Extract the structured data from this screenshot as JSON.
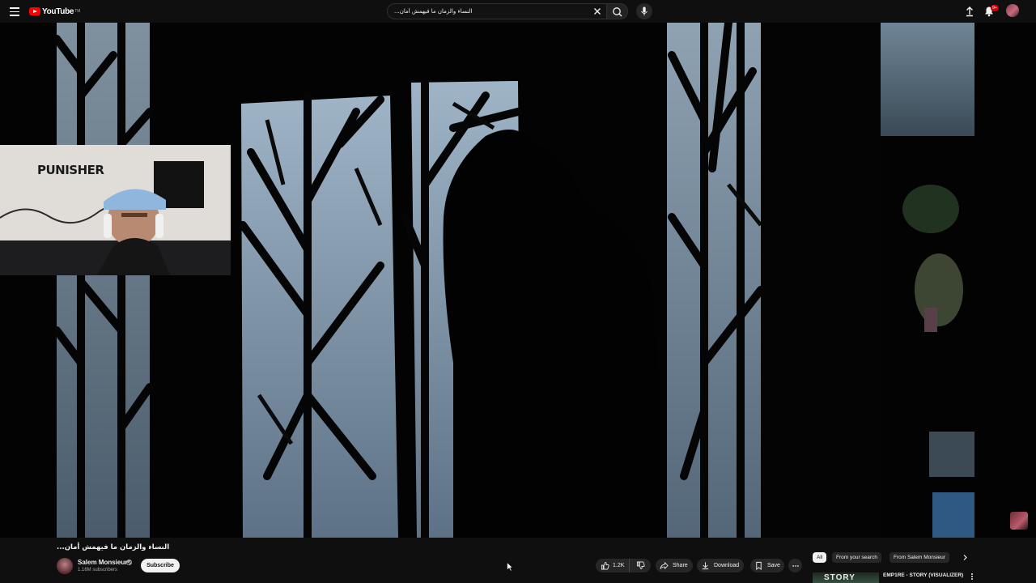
{
  "header": {
    "logo_text": "YouTube",
    "logo_tm": "TM",
    "search_value": "...النساء والزمان ما فيهمش أمان",
    "notification_count": "9+"
  },
  "video": {
    "title": "...النساء والزمان ما فيهمش أمان",
    "channel_name": "Salem Monsieur",
    "subscribers": "1.16M subscribers",
    "subscribe_label": "Subscribe",
    "webcam_poster_text": "PUNISHER"
  },
  "actions": {
    "like_count": "1.2K",
    "share_label": "Share",
    "download_label": "Download",
    "save_label": "Save"
  },
  "sidebar": {
    "chips": [
      {
        "label": "All",
        "active": true
      },
      {
        "label": "From your search",
        "active": false
      },
      {
        "label": "From Salem Monsieur",
        "active": false
      }
    ],
    "recommendation": {
      "title": "EMP1RE - STORY (VISUALIZER)",
      "thumb_text": "STORY"
    }
  },
  "colors": {
    "background": "#0f0f0f",
    "brand_red": "#ff0000",
    "pill": "#272727",
    "text": "#f1f1f1",
    "secondary_text": "#aaaaaa"
  }
}
